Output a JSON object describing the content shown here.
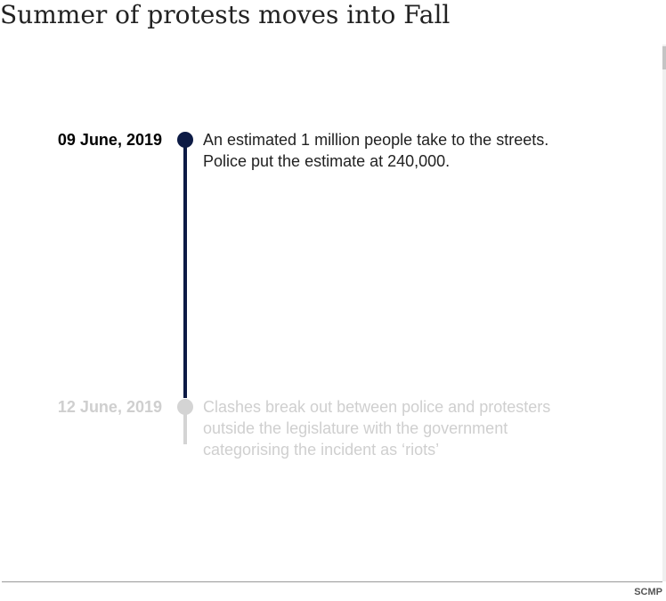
{
  "title": "Summer of protests moves into Fall",
  "colors": {
    "active_line": "#0d1b45",
    "inactive": "#d4d4d4",
    "inactive_text": "#cfcfcf",
    "text": "#222222"
  },
  "timeline": {
    "events": [
      {
        "date": "09 June, 2019",
        "text": "An estimated 1 million people take to the streets.\nPolice put the estimate at 240,000.",
        "state": "active"
      },
      {
        "date": "12 June, 2019",
        "text": "Clashes break out between police and protesters\noutside the legislature with the government\ncategorising the incident as ‘riots’",
        "state": "inactive"
      }
    ]
  },
  "footer": {
    "source": "SCMP"
  }
}
